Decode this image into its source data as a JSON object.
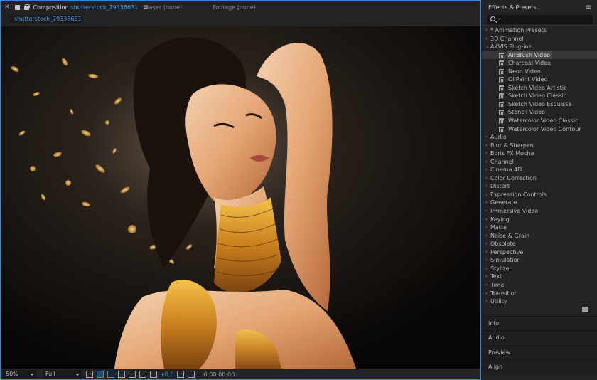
{
  "composition": {
    "prefix": "Composition",
    "name": "shutterstock_79338631",
    "layer": "Layer (none)",
    "footage": "Footage (none)",
    "tab": "shutterstock_79338631"
  },
  "footer": {
    "zoom": "50%",
    "resolution": "Full",
    "exposure": "+0,0",
    "timecode": "0:00:00:00"
  },
  "effects": {
    "title": "Effects & Presets",
    "tree": [
      {
        "label": "* Animation Presets",
        "arrow": "›",
        "level": 0
      },
      {
        "label": "3D Channel",
        "arrow": "›",
        "level": 0
      },
      {
        "label": "AKVIS Plug-ins",
        "arrow": "⌄",
        "level": 0
      },
      {
        "label": "AirBrush Video",
        "level": 1,
        "selected": true
      },
      {
        "label": "Charcoal Video",
        "level": 1
      },
      {
        "label": "Neon Video",
        "level": 1
      },
      {
        "label": "OilPaint Video",
        "level": 1
      },
      {
        "label": "Sketch Video Artistic",
        "level": 1
      },
      {
        "label": "Sketch Video Classic",
        "level": 1
      },
      {
        "label": "Sketch Video Esquisse",
        "level": 1
      },
      {
        "label": "Stencil Video",
        "level": 1
      },
      {
        "label": "Watercolor Video Classic",
        "level": 1
      },
      {
        "label": "Watercolor Video Contour",
        "level": 1
      },
      {
        "label": "Audio",
        "arrow": "›",
        "level": 0
      },
      {
        "label": "Blur & Sharpen",
        "arrow": "›",
        "level": 0
      },
      {
        "label": "Boris FX Mocha",
        "arrow": "›",
        "level": 0
      },
      {
        "label": "Channel",
        "arrow": "›",
        "level": 0
      },
      {
        "label": "Cinema 4D",
        "arrow": "›",
        "level": 0
      },
      {
        "label": "Color Correction",
        "arrow": "›",
        "level": 0
      },
      {
        "label": "Distort",
        "arrow": "›",
        "level": 0
      },
      {
        "label": "Expression Controls",
        "arrow": "›",
        "level": 0
      },
      {
        "label": "Generate",
        "arrow": "›",
        "level": 0
      },
      {
        "label": "Immersive Video",
        "arrow": "›",
        "level": 0
      },
      {
        "label": "Keying",
        "arrow": "›",
        "level": 0
      },
      {
        "label": "Matte",
        "arrow": "›",
        "level": 0
      },
      {
        "label": "Noise & Grain",
        "arrow": "›",
        "level": 0
      },
      {
        "label": "Obsolete",
        "arrow": "›",
        "level": 0
      },
      {
        "label": "Perspective",
        "arrow": "›",
        "level": 0
      },
      {
        "label": "Simulation",
        "arrow": "›",
        "level": 0
      },
      {
        "label": "Stylize",
        "arrow": "›",
        "level": 0
      },
      {
        "label": "Text",
        "arrow": "›",
        "level": 0
      },
      {
        "label": "Time",
        "arrow": "›",
        "level": 0
      },
      {
        "label": "Transition",
        "arrow": "›",
        "level": 0
      },
      {
        "label": "Utility",
        "arrow": "›",
        "level": 0
      }
    ]
  },
  "panels": {
    "info": "Info",
    "audio": "Audio",
    "preview": "Preview",
    "align": "Align"
  },
  "colors": {
    "accent_blue": "#2d8ceb",
    "link_blue": "#4a9eea"
  }
}
